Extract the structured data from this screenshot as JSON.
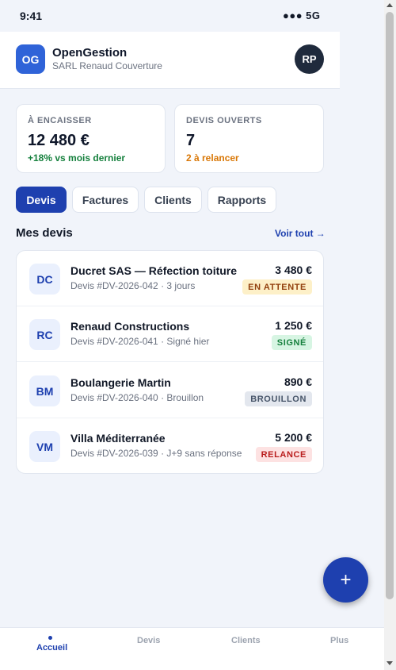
{
  "status_bar": {
    "time": "9:41",
    "signal": "●●● 5G"
  },
  "header": {
    "logo_text": "OG",
    "app_name": "OpenGestion",
    "company": "SARL Renaud Couverture",
    "avatar_initials": "RP"
  },
  "kpis": [
    {
      "label": "À ENCAISSER",
      "value": "12 480 €",
      "sub": "+18% vs mois dernier"
    },
    {
      "label": "DEVIS OUVERTS",
      "value": "7",
      "sub": "2 à relancer"
    }
  ],
  "tabs": [
    {
      "label": "Devis",
      "active": true
    },
    {
      "label": "Factures",
      "active": false
    },
    {
      "label": "Clients",
      "active": false
    },
    {
      "label": "Rapports",
      "active": false
    }
  ],
  "section": {
    "title": "Mes devis",
    "see_all": "Voir tout →"
  },
  "quotes": [
    {
      "initials": "DC",
      "title": "Ducret SAS — Réfection toiture",
      "meta": "Devis #DV-2026-042 · 3 jours",
      "amount": "3 480 €",
      "status": "EN ATTENTE"
    },
    {
      "initials": "RC",
      "title": "Renaud Constructions",
      "meta": "Devis #DV-2026-041 · Signé hier",
      "amount": "1 250 €",
      "status": "SIGNÉ"
    },
    {
      "initials": "BM",
      "title": "Boulangerie Martin",
      "meta": "Devis #DV-2026-040 · Brouillon",
      "amount": "890 €",
      "status": "BROUILLON"
    },
    {
      "initials": "VM",
      "title": "Villa Méditerranée",
      "meta": "Devis #DV-2026-039 · J+9 sans réponse",
      "amount": "5 200 €",
      "status": "RELANCE"
    }
  ],
  "fab": {
    "icon": "plus-icon",
    "label": "+"
  },
  "bottom_nav": [
    {
      "label": "Accueil",
      "active": true
    },
    {
      "label": "Devis",
      "active": false
    },
    {
      "label": "Clients",
      "active": false
    },
    {
      "label": "Plus",
      "active": false
    }
  ],
  "colors": {
    "primary": "#1e40af",
    "logo": "#2f63d8",
    "positive": "#15803d",
    "warning": "#d97706",
    "danger": "#b91c1c"
  }
}
